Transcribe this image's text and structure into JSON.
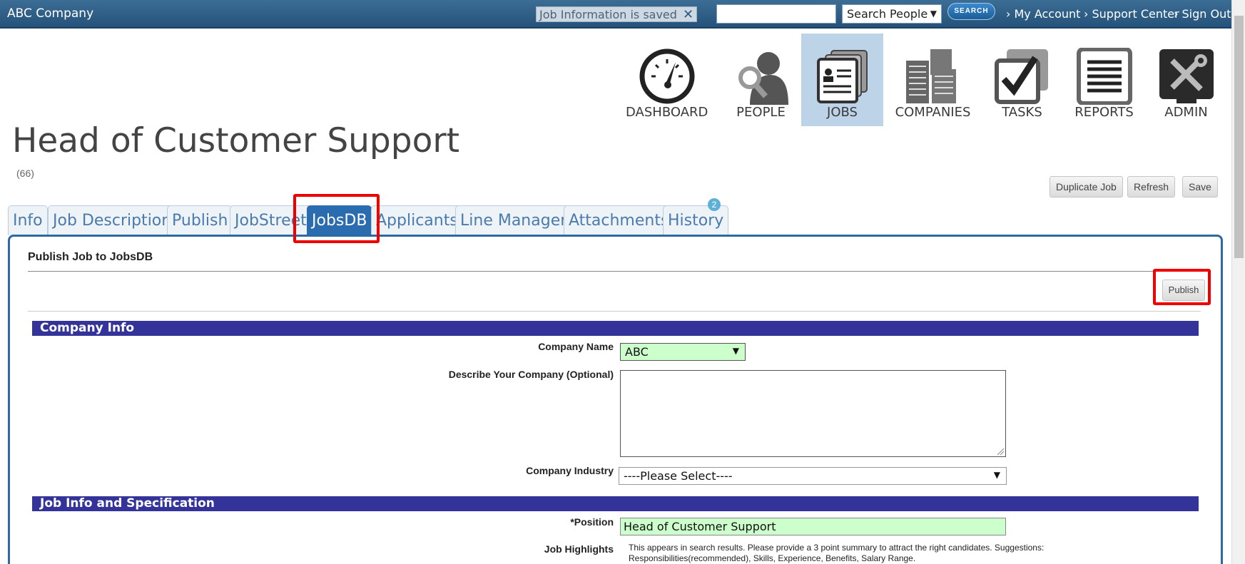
{
  "topbar": {
    "company": "ABC Company",
    "notice": "Job Information is saved",
    "notice_close": "✕",
    "search_value": "",
    "search_scope": "Search People",
    "search_button": "SEARCH",
    "links": [
      "My Account",
      "Support Center",
      "Sign Out"
    ]
  },
  "nav": [
    {
      "label": "DASHBOARD",
      "icon": "dashboard-icon"
    },
    {
      "label": "PEOPLE",
      "icon": "people-icon"
    },
    {
      "label": "JOBS",
      "icon": "jobs-icon",
      "active": true
    },
    {
      "label": "COMPANIES",
      "icon": "companies-icon"
    },
    {
      "label": "TASKS",
      "icon": "tasks-icon"
    },
    {
      "label": "REPORTS",
      "icon": "reports-icon"
    },
    {
      "label": "ADMIN",
      "icon": "admin-icon"
    }
  ],
  "page": {
    "title": "Head of Customer Support",
    "id": "(66)",
    "buttons": {
      "duplicate": "Duplicate Job",
      "refresh": "Refresh",
      "save": "Save"
    }
  },
  "tabs": [
    "Info",
    "Job Description",
    "Publish",
    "JobStreet",
    "JobsDB",
    "Applicants",
    "Line Manager",
    "Attachments",
    "History"
  ],
  "active_tab": "JobsDB",
  "history_badge": "2",
  "panel": {
    "title": "Publish Job to JobsDB",
    "publish_button": "Publish",
    "sections": {
      "company_info": "Company Info",
      "job_info": "Job Info and Specification"
    },
    "fields": {
      "company_name_label": "Company Name",
      "company_name_value": "ABC",
      "describe_label": "Describe Your Company (Optional)",
      "describe_value": "",
      "industry_label": "Company Industry",
      "industry_value": "----Please Select----",
      "position_label": "*Position",
      "position_value": "Head of Customer Support",
      "highlights_label": "Job Highlights",
      "highlights_help": "This appears in search results. Please provide a 3 point summary to attract the right candidates. Suggestions: Responsibilities(recommended), Skills, Experience, Benefits, Salary Range."
    }
  },
  "colors": {
    "topbar": "#24527a",
    "section_bar": "#333399",
    "required_field": "#ccffcc",
    "active_tab": "#2b6cb0",
    "highlight": "#ee0000"
  }
}
